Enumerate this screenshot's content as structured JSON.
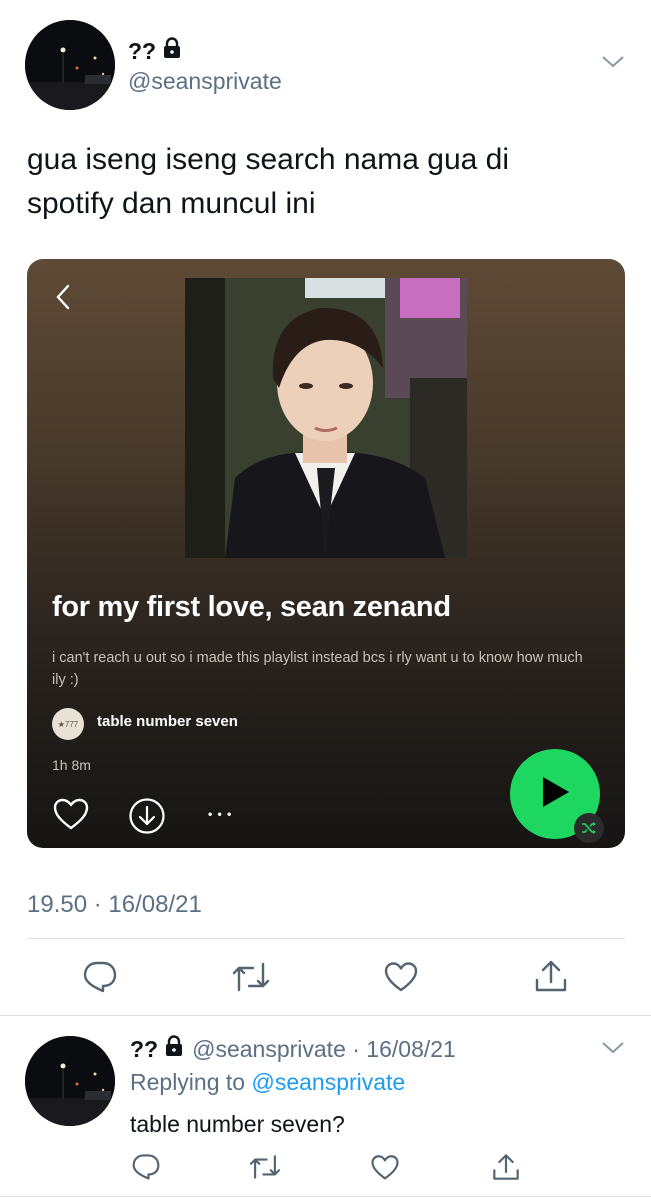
{
  "tweet": {
    "author_name": "??",
    "handle": "@seansprivate",
    "text_line1": "gua iseng iseng search nama gua di",
    "text_line2": "spotify dan muncul ini",
    "timestamp": "19.50 · 16/08/21"
  },
  "playlist": {
    "title": "for my first love, sean zenand",
    "description": "i can't reach u out so i made this playlist instead bcs i rly want u to know how much ily :)",
    "owner_avatar_text": "★777",
    "owner": "table number seven",
    "duration": "1h 8m",
    "more_label": "• • •",
    "accent_color": "#1ed760"
  },
  "reply": {
    "author_name": "??",
    "meta": "@seansprivate · 16/08/21",
    "replying_prefix": "Replying to",
    "replying_to": "@seansprivate",
    "text": "table number seven?"
  },
  "icons": [
    "lock-icon",
    "chevron-down-icon",
    "back-arrow-icon",
    "heart-icon",
    "download-icon",
    "play-icon",
    "shuffle-icon",
    "reply-icon",
    "retweet-icon",
    "like-icon",
    "share-icon"
  ]
}
